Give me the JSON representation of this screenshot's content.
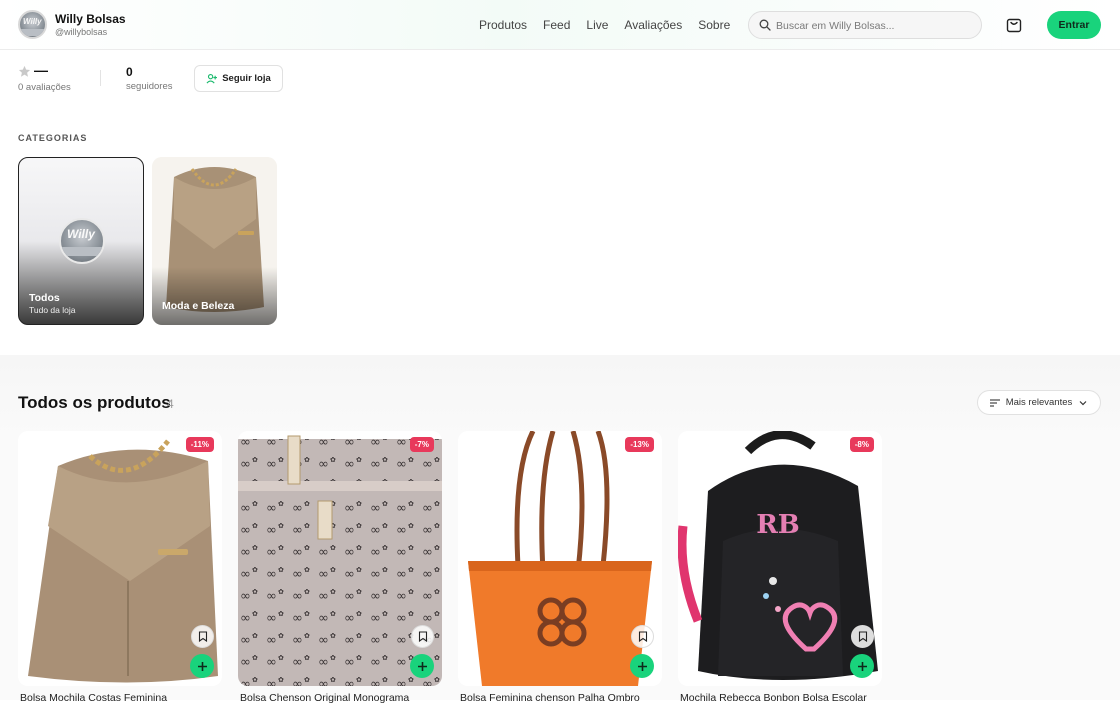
{
  "header": {
    "store_name": "Willy Bolsas",
    "store_handle": "@willybolsas",
    "logo_text": "Willy",
    "nav": [
      "Produtos",
      "Feed",
      "Live",
      "Avaliações",
      "Sobre"
    ],
    "search_placeholder": "Buscar em Willy Bolsas...",
    "login_label": "Entrar",
    "accent_color": "#19d37c"
  },
  "stats": {
    "rating_value": "—",
    "rating_label": "0 avaliações",
    "followers_value": "0",
    "followers_label": "seguidores",
    "follow_label": "Seguir loja"
  },
  "categories": {
    "title": "CATEGORIAS",
    "items": [
      {
        "label": "Todos",
        "sub": "Tudo da loja"
      },
      {
        "label": "Moda e Beleza",
        "sub": ""
      }
    ]
  },
  "products": {
    "title": "Todos os produtos",
    "count": "4",
    "sort_label": "Mais relevantes",
    "items": [
      {
        "title": "Bolsa Mochila Costas Feminina",
        "badge": "-11%",
        "icon": "beige-backpack"
      },
      {
        "title": "Bolsa Chenson Original Monograma",
        "badge": "-7%",
        "icon": "monogram-bag"
      },
      {
        "title": "Bolsa Feminina chenson Palha Ombro",
        "badge": "-13%",
        "icon": "straw-tote"
      },
      {
        "title": "Mochila Rebecca Bonbon Bolsa Escolar",
        "badge": "-8%",
        "icon": "black-backpack"
      }
    ],
    "badge_color": "#e8395b"
  }
}
